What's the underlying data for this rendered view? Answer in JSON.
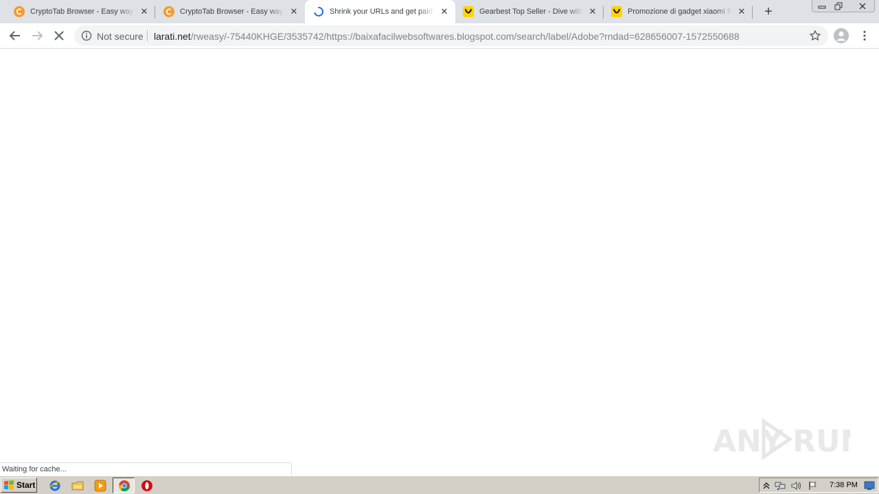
{
  "browser": {
    "tabs": [
      {
        "title": "CryptoTab Browser - Easy way to",
        "favicon": "cryptotab-icon",
        "active": false
      },
      {
        "title": "CryptoTab Browser - Easy way to",
        "favicon": "cryptotab-icon",
        "active": false
      },
      {
        "title": "Shrink your URLs and get paid!",
        "favicon": "loading-spinner-icon",
        "active": true
      },
      {
        "title": "Gearbest Top Seller - Dive with",
        "favicon": "gearbest-icon",
        "active": false
      },
      {
        "title": "Promozione di gadget xiaomi finc",
        "favicon": "gearbest-icon",
        "active": false
      }
    ],
    "toolbar": {
      "security_label": "Not secure",
      "url_host": "larati.net",
      "url_rest": "/rweasy/-75440KHGE/3535742/https://baixafacilwebsoftwares.blogspot.com/search/label/Adobe?rndad=628656007-1572550688"
    },
    "status_text": "Waiting for cache...",
    "watermark": "ANY RUN"
  },
  "taskbar": {
    "start_label": "Start",
    "clock": "7:38 PM"
  },
  "colors": {
    "tabstrip": "#dee1e6",
    "omnibox": "#f1f3f4",
    "cryptotab": "#f29b30",
    "gearbest": "#ffd400",
    "spinner": "#1a73e8",
    "taskbar": "#d4d0c8"
  }
}
